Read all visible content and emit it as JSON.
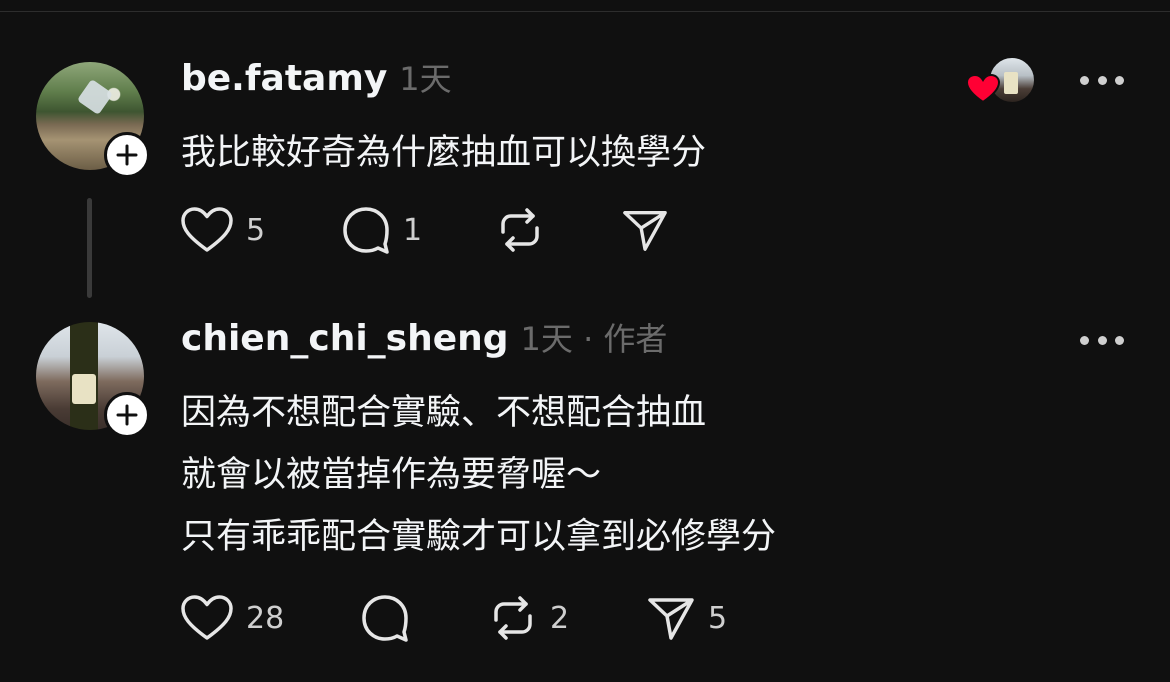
{
  "posts": [
    {
      "username": "be.fatamy",
      "meta": "1天",
      "lines": [
        "我比較好奇為什麼抽血可以換學分"
      ],
      "likes": "5",
      "replies": "1",
      "reposts": "",
      "shares": ""
    },
    {
      "username": "chien_chi_sheng",
      "meta": "1天 · 作者",
      "lines": [
        "因為不想配合實驗、不想配合抽血",
        "就會以被當掉作為要脅喔～",
        "只有乖乖配合實驗才可以拿到必修學分"
      ],
      "likes": "28",
      "replies": "",
      "reposts": "2",
      "shares": "5"
    }
  ],
  "colors": {
    "background": "#101010",
    "text": "#f3f5f7",
    "muted": "#6b6b6b",
    "like_heart": "#ff0034"
  },
  "icons": {
    "follow": "plus-icon",
    "like": "heart-icon",
    "reply": "comment-icon",
    "repost": "repost-icon",
    "share": "send-icon",
    "more": "more-dots-icon"
  }
}
